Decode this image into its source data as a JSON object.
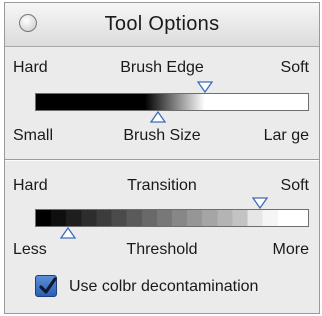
{
  "window": {
    "title": "Tool Options"
  },
  "brush_edge": {
    "left_label": "Hard",
    "center_label": "Brush Edge",
    "right_label": "Soft",
    "value": 0.62
  },
  "brush_size": {
    "left_label": "Small",
    "center_label": "Brush Size",
    "right_label": "Lar ge",
    "value": 0.45
  },
  "transition": {
    "left_label": "Hard",
    "center_label": "Transition",
    "right_label": "Soft",
    "value": 0.82
  },
  "threshold": {
    "left_label": "Less",
    "center_label": "Threshold",
    "right_label": "More",
    "value": 0.12
  },
  "decontamination": {
    "label": "Use colbr decontamination",
    "checked": true
  },
  "colors": {
    "checkbox_accent": "#2b5fb4"
  }
}
